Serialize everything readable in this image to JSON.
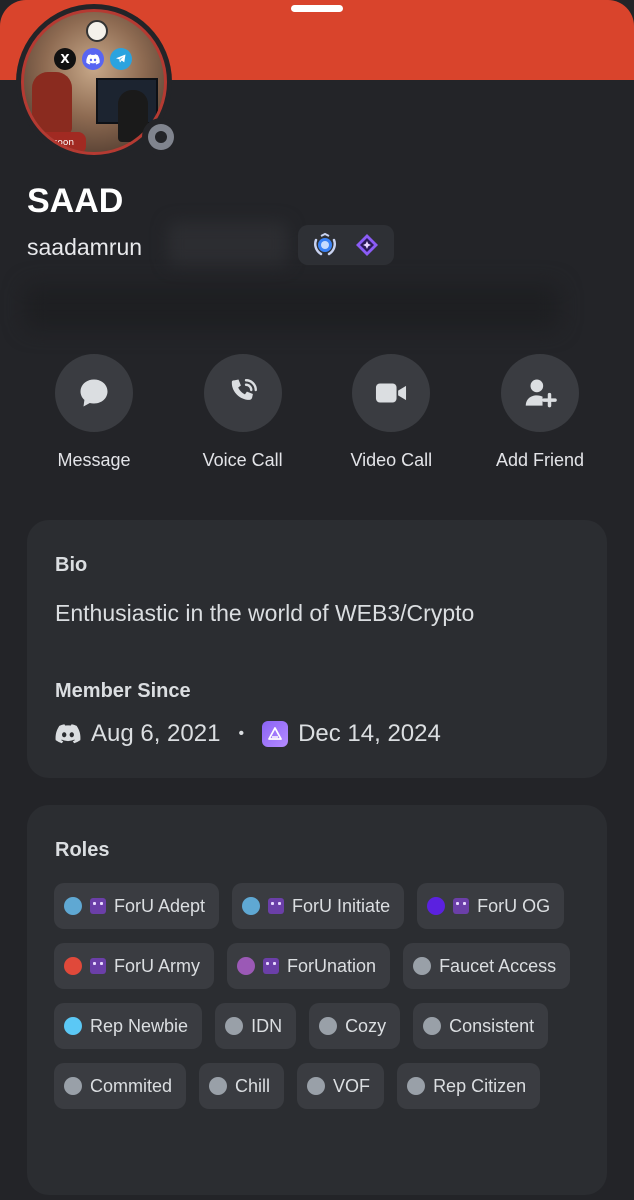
{
  "theme": {
    "banner_color": "#d9442c",
    "background": "#232428",
    "card_background": "#2b2d31",
    "status": "offline"
  },
  "avatar": {
    "socials": [
      "X",
      "discord-icon",
      "telegram-icon"
    ],
    "base_text": "Raccoon"
  },
  "profile": {
    "display_name": "SAAD",
    "username": "saadamrun",
    "badges": [
      "laurel-badge-icon",
      "nitro-gem-badge-icon"
    ]
  },
  "actions": [
    {
      "label": "Message",
      "icon": "chat-bubble-icon"
    },
    {
      "label": "Voice Call",
      "icon": "phone-icon"
    },
    {
      "label": "Video Call",
      "icon": "video-camera-icon"
    },
    {
      "label": "Add Friend",
      "icon": "add-friend-icon"
    }
  ],
  "bio": {
    "title": "Bio",
    "text": "Enthusiastic in the world of WEB3/Crypto"
  },
  "member_since": {
    "title": "Member Since",
    "discord_date": "Aug 6, 2021",
    "separator": "•",
    "server_date": "Dec 14, 2024"
  },
  "roles": {
    "title": "Roles",
    "items": [
      {
        "label": "ForU Adept",
        "color": "#5fa8d3",
        "emoji": true
      },
      {
        "label": "ForU Initiate",
        "color": "#5fa8d3",
        "emoji": true
      },
      {
        "label": "ForU OG",
        "color": "#5b21e0",
        "emoji": true
      },
      {
        "label": "ForU Army",
        "color": "#e0493a",
        "emoji": true
      },
      {
        "label": "ForUnation",
        "color": "#9b59b6",
        "emoji": true
      },
      {
        "label": "Faucet Access",
        "color": "#99a0a8",
        "emoji": false
      },
      {
        "label": "Rep Newbie",
        "color": "#5bc8f5",
        "emoji": false
      },
      {
        "label": "IDN",
        "color": "#99a0a8",
        "emoji": false
      },
      {
        "label": "Cozy",
        "color": "#99a0a8",
        "emoji": false
      },
      {
        "label": "Consistent",
        "color": "#99a0a8",
        "emoji": false
      },
      {
        "label": "Commited",
        "color": "#99a0a8",
        "emoji": false
      },
      {
        "label": "Chill",
        "color": "#99a0a8",
        "emoji": false
      },
      {
        "label": "VOF",
        "color": "#99a0a8",
        "emoji": false
      },
      {
        "label": "Rep Citizen",
        "color": "#99a0a8",
        "emoji": false
      }
    ]
  }
}
